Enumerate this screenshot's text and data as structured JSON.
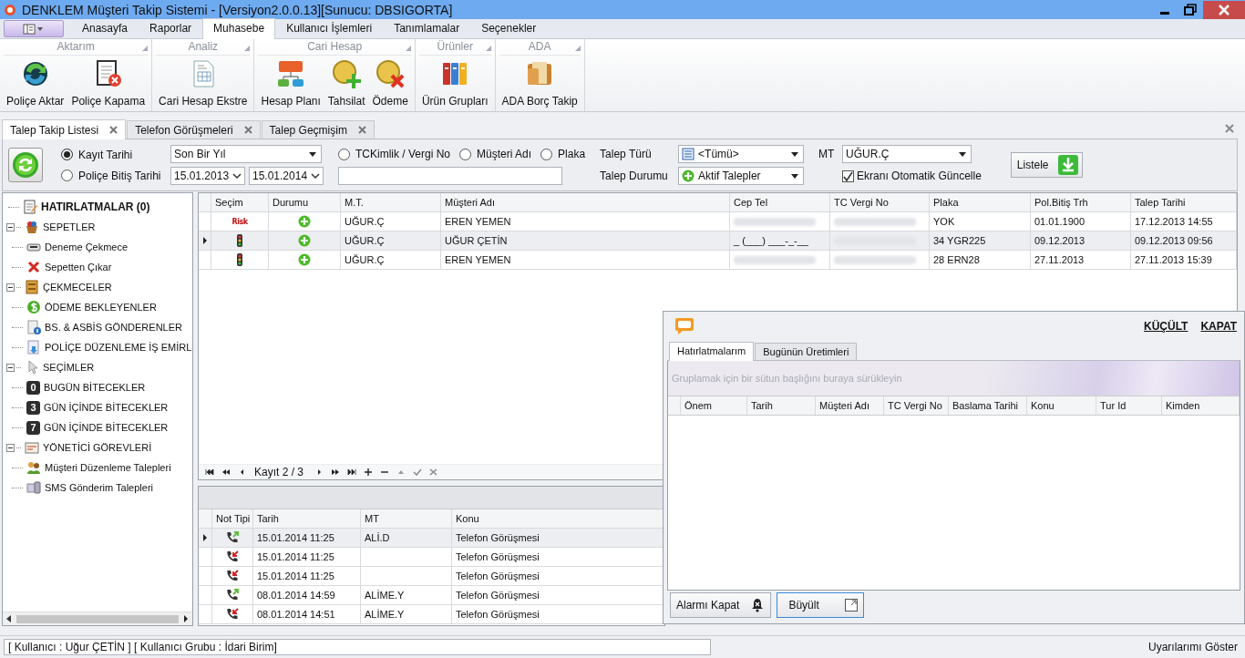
{
  "window": {
    "title": "DENKLEM Müşteri Takip Sistemi - [Versiyon2.0.0.13][Sunucu: DBSIGORTA]"
  },
  "ribbon_tabs": [
    {
      "label": "Anasayfa",
      "selected": false
    },
    {
      "label": "Raporlar",
      "selected": false
    },
    {
      "label": "Muhasebe",
      "selected": true
    },
    {
      "label": "Kullanıcı İşlemleri",
      "selected": false
    },
    {
      "label": "Tanımlamalar",
      "selected": false
    },
    {
      "label": "Seçenekler",
      "selected": false
    }
  ],
  "ribbon_groups": [
    {
      "title": "Aktarım",
      "buttons": [
        {
          "label": "Poliçe Aktar",
          "kind": "sync"
        },
        {
          "label": "Poliçe Kapama",
          "kind": "doc-cancel"
        }
      ]
    },
    {
      "title": "Analiz",
      "buttons": [
        {
          "label": "Cari Hesap Ekstre",
          "kind": "document"
        }
      ]
    },
    {
      "title": "Cari Hesap",
      "buttons": [
        {
          "label": "Hesap Planı",
          "kind": "hierarchy"
        },
        {
          "label": "Tahsilat",
          "kind": "coin-plus"
        },
        {
          "label": "Ödeme",
          "kind": "coin-x"
        }
      ]
    },
    {
      "title": "Ürünler",
      "buttons": [
        {
          "label": "Ürün Grupları",
          "kind": "binders"
        }
      ]
    },
    {
      "title": "ADA",
      "buttons": [
        {
          "label": "ADA Borç Takip",
          "kind": "wallet"
        }
      ]
    }
  ],
  "doc_tabs": [
    {
      "label": "Talep Takip Listesi",
      "selected": true
    },
    {
      "label": "Telefon Görüşmeleri",
      "selected": false
    },
    {
      "label": "Talep Geçmişim",
      "selected": false
    }
  ],
  "filter": {
    "date_mode": [
      {
        "label": "Kayıt Tarihi",
        "selected": true
      },
      {
        "label": "Poliçe Bitiş Tarihi",
        "selected": false
      }
    ],
    "period": "Son Bir Yıl",
    "date_from": "15.01.2013",
    "date_to": "15.01.2014",
    "search_mode": [
      {
        "label": "TCKimlik / Vergi No",
        "selected": false
      },
      {
        "label": "Müşteri Adı",
        "selected": false
      },
      {
        "label": "Plaka",
        "selected": false
      }
    ],
    "type_label": "Talep Türü",
    "type_value": "<Tümü>",
    "status_label": "Talep Durumu",
    "status_value": "Aktif Talepler",
    "mt_label": "MT",
    "mt_value": "UĞUR.Ç",
    "auto_refresh": {
      "label": "Ekranı Otomatik Güncelle",
      "checked": true
    },
    "list_button": "Listele"
  },
  "tree": [
    {
      "label": "HATIRLATMALAR (0)",
      "kind": "note",
      "bold": true
    },
    {
      "label": "SEPETLER",
      "kind": "basket",
      "expanded": true,
      "children": [
        {
          "label": "Deneme Çekmece",
          "kind": "drawer"
        },
        {
          "label": "Sepetten Çıkar",
          "kind": "cross"
        }
      ]
    },
    {
      "label": "ÇEKMECELER",
      "kind": "cabinet",
      "expanded": true,
      "children": [
        {
          "label": "ÖDEME BEKLEYENLER",
          "kind": "coin"
        },
        {
          "label": "BS. & ASBİS GÖNDERENLER",
          "kind": "doc-info"
        },
        {
          "label": "POLİÇE DÜZENLEME İŞ EMİRL",
          "kind": "doc-arrow"
        }
      ]
    },
    {
      "label": "SEÇİMLER",
      "kind": "pointer",
      "expanded": true,
      "children": [
        {
          "label": "BUGÜN BİTECEKLER",
          "badge": "0"
        },
        {
          "label": "GÜN İÇİNDE BİTECEKLER",
          "badge": "3"
        },
        {
          "label": "GÜN İÇİNDE BİTECEKLER",
          "badge": "7"
        }
      ]
    },
    {
      "label": "YÖNETİCİ GÖREVLERİ",
      "kind": "notepad",
      "expanded": true,
      "children": [
        {
          "label": "Müşteri Düzenleme Talepleri",
          "kind": "people"
        },
        {
          "label": "SMS Gönderim Talepleri",
          "kind": "device"
        }
      ]
    }
  ],
  "grid": {
    "columns": [
      "Seçim",
      "Durumu",
      "M.T.",
      "Müşteri Adı",
      "Cep Tel",
      "TC Vergi No",
      "Plaka",
      "Pol.Bitiş Trh",
      "Talep Tarihi"
    ],
    "rows": [
      {
        "current": false,
        "secim": {
          "kind": "risk",
          "label": "Risk"
        },
        "durum": {
          "kind": "active"
        },
        "mt": "UĞUR.Ç",
        "musteri": "EREN YEMEN",
        "cep_tel": {
          "blurred": true
        },
        "tc": {
          "blurred": true
        },
        "plaka": "YOK",
        "bitis": "01.01.1900",
        "talep": "17.12.2013 14:55"
      },
      {
        "current": true,
        "secim": {
          "kind": "traffic-light"
        },
        "durum": {
          "kind": "active"
        },
        "mt": "UĞUR.Ç",
        "musteri": "UĞUR ÇETİN",
        "cep_tel": {
          "blurred": false,
          "text": "_ (___) ___-_-__"
        },
        "tc": {
          "blurred": true
        },
        "plaka": "34 YGR225",
        "bitis": "09.12.2013",
        "talep": "09.12.2013 09:56"
      },
      {
        "current": false,
        "secim": {
          "kind": "traffic-light"
        },
        "durum": {
          "kind": "active"
        },
        "mt": "UĞUR.Ç",
        "musteri": "EREN YEMEN",
        "cep_tel": {
          "blurred": true
        },
        "tc": {
          "blurred": true
        },
        "plaka": "28 ERN28",
        "bitis": "27.11.2013",
        "talep": "27.11.2013 15:39"
      }
    ]
  },
  "navigator": {
    "record": "Kayıt 2 / 3"
  },
  "notes": {
    "columns": [
      "Not Tipi",
      "Tarih",
      "MT",
      "Konu"
    ],
    "rows": [
      {
        "current": true,
        "call": {
          "kind": "outgoing"
        },
        "tarih": "15.01.2014 11:25",
        "mt": "ALİ.D",
        "konu": "Telefon Görüşmesi"
      },
      {
        "current": false,
        "call": {
          "kind": "incoming"
        },
        "tarih": "15.01.2014 11:25",
        "konu": "Telefon Görüşmesi"
      },
      {
        "current": false,
        "call": {
          "kind": "incoming"
        },
        "tarih": "15.01.2014 11:25",
        "konu": "Telefon Görüşmesi"
      },
      {
        "current": false,
        "call": {
          "kind": "outgoing"
        },
        "tarih": "08.01.2014 14:59",
        "mt": "ALİME.Y",
        "konu": "Telefon Görüşmesi"
      },
      {
        "current": false,
        "call": {
          "kind": "incoming"
        },
        "tarih": "08.01.2014 14:51",
        "mt": "ALİME.Y",
        "konu": "Telefon Görüşmesi"
      }
    ]
  },
  "popup": {
    "actions": [
      "KÜÇÜLT",
      "KAPAT"
    ],
    "tabs": [
      {
        "label": "Hatırlatmalarım",
        "selected": true
      },
      {
        "label": "Bugünün Üretimleri",
        "selected": false
      }
    ],
    "group_hint": "Gruplamak için bir sütun başlığını buraya sürükleyin",
    "columns": [
      "Önem",
      "Tarih",
      "Müşteri Adı",
      "TC Vergi No",
      "Baslama Tarihi",
      "Konu",
      "Tur Id",
      "Kimden"
    ],
    "buttons": [
      {
        "label": "Alarmı Kapat",
        "kind": "bell",
        "focused": false
      },
      {
        "label": "Büyült",
        "kind": "expand",
        "focused": true
      }
    ]
  },
  "status_bar": {
    "user": "[ Kullanıcı : Uğur ÇETİN ] [ Kullanıcı Grubu : İdari Birim]",
    "alerts": "Uyarılarımı Göster"
  }
}
